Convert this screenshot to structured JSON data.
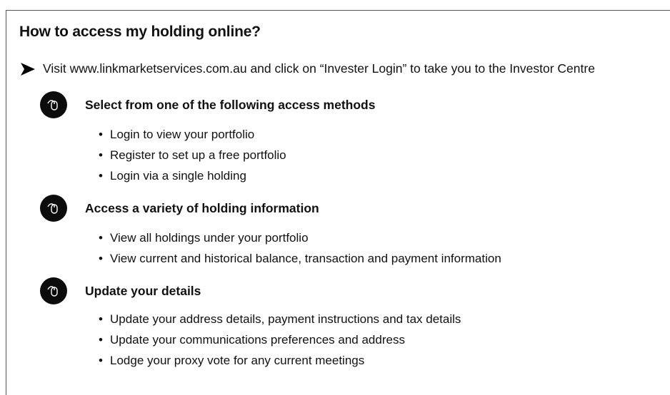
{
  "title": "How to access my holding online?",
  "intro": {
    "icon": "arrow-right-icon",
    "text": "Visit www.linkmarketservices.com.au and click on “Invester Login” to take you to the Investor Centre"
  },
  "sections": [
    {
      "icon": "mouse-icon",
      "heading": "Select from one of the following access methods",
      "items": [
        "Login to view your portfolio",
        "Register to set up a free portfolio",
        "Login via a single holding"
      ]
    },
    {
      "icon": "mouse-icon",
      "heading": "Access a variety of holding information",
      "items": [
        "View all holdings under your portfolio",
        "View current and historical balance, transaction and payment information"
      ]
    },
    {
      "icon": "mouse-icon",
      "heading": "Update your details",
      "items": [
        "Update your address details, payment instructions and tax details",
        "Update your communications preferences and address",
        "Lodge your proxy vote for any current meetings"
      ]
    }
  ]
}
